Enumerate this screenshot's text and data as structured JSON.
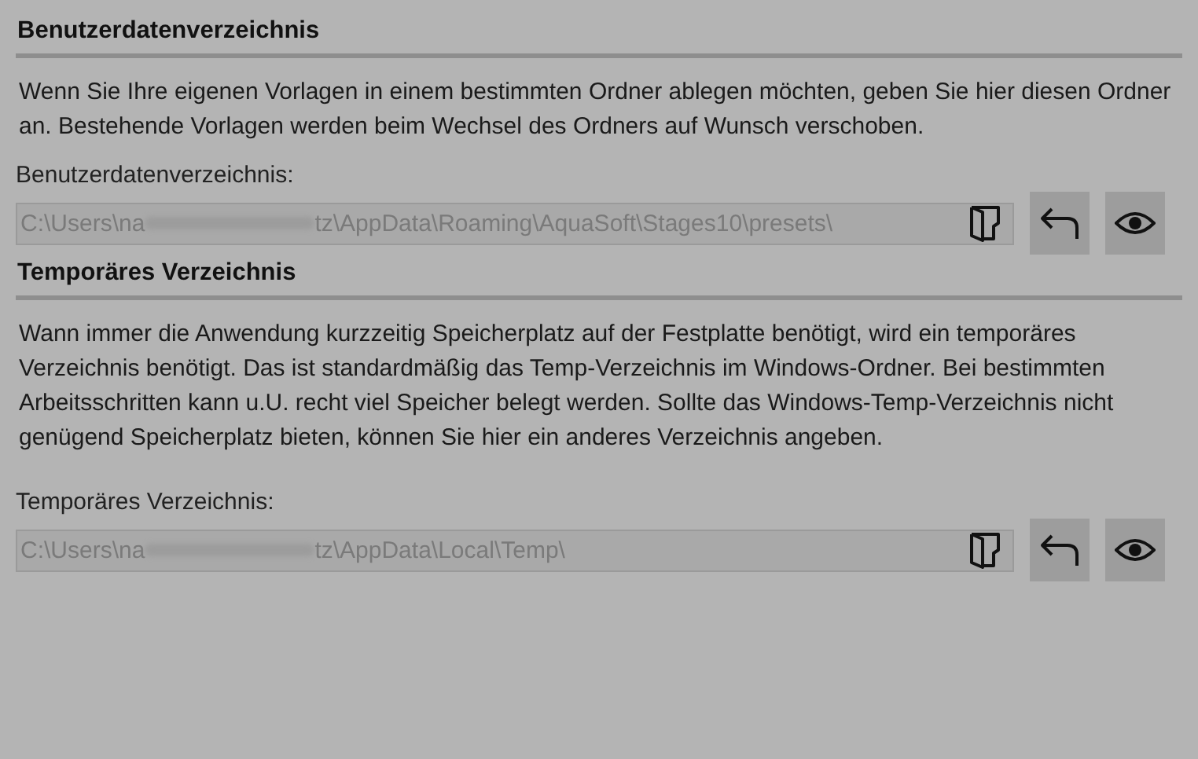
{
  "sections": [
    {
      "heading": "Benutzerdatenverzeichnis",
      "description": "Wenn Sie Ihre eigenen Vorlagen in einem bestimmten Ordner ablegen möchten, geben Sie hier diesen Ordner an. Bestehende Vorlagen werden beim Wechsel des Ordners auf Wunsch verschoben.",
      "field_label": "Benutzerdatenverzeichnis:",
      "path_before": "C:\\Users\\na",
      "path_redacted": true,
      "path_after": "tz\\AppData\\Roaming\\AquaSoft\\Stages10\\presets\\"
    },
    {
      "heading": "Temporäres Verzeichnis",
      "description": "Wann immer die Anwendung kurzzeitig Speicherplatz auf der Festplatte benötigt, wird ein temporäres Verzeichnis benötigt. Das ist standardmäßig das Temp-Verzeichnis im Windows-Ordner. Bei bestimmten Arbeitsschritten kann u.U. recht viel Speicher belegt werden. Sollte das Windows-Temp-Verzeichnis nicht genügend Speicherplatz bieten, können Sie hier ein anderes Verzeichnis angeben.",
      "field_label": "Temporäres Verzeichnis:",
      "path_before": "C:\\Users\\na",
      "path_redacted": true,
      "path_after": "tz\\AppData\\Local\\Temp\\"
    }
  ]
}
